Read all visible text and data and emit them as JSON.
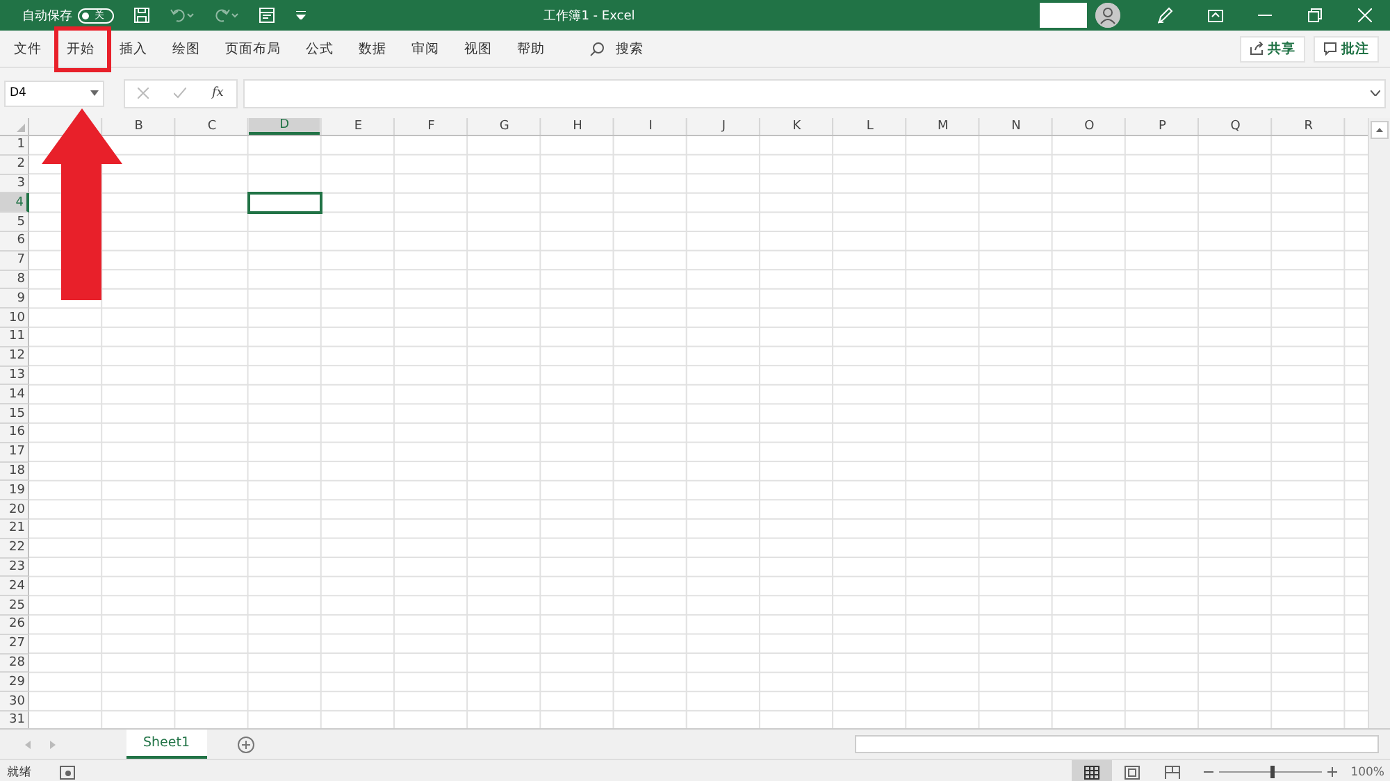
{
  "title_bar": {
    "autosave_label": "自动保存",
    "autosave_on": false,
    "autosave_state": "关",
    "title": "工作簿1  -  Excel"
  },
  "ribbon_tabs": [
    {
      "label": "文件",
      "selected": false
    },
    {
      "label": "开始",
      "selected": false
    },
    {
      "label": "插入",
      "selected": false
    },
    {
      "label": "绘图",
      "selected": false
    },
    {
      "label": "页面布局",
      "selected": false
    },
    {
      "label": "公式",
      "selected": false
    },
    {
      "label": "数据",
      "selected": false
    },
    {
      "label": "审阅",
      "selected": false
    },
    {
      "label": "视图",
      "selected": false
    },
    {
      "label": "帮助",
      "selected": false
    }
  ],
  "search": {
    "label": "搜索"
  },
  "ribbon_buttons": {
    "share": "共享",
    "comments": "批注"
  },
  "formula_bar": {
    "name_box": "D4",
    "fx": "fx"
  },
  "grid": {
    "columns": [
      {
        "label": "B",
        "selected": false
      },
      {
        "label": "C",
        "selected": false
      },
      {
        "label": "D",
        "selected": true
      },
      {
        "label": "E",
        "selected": false
      },
      {
        "label": "F",
        "selected": false
      },
      {
        "label": "G",
        "selected": false
      },
      {
        "label": "H",
        "selected": false
      },
      {
        "label": "I",
        "selected": false
      },
      {
        "label": "J",
        "selected": false
      },
      {
        "label": "K",
        "selected": false
      },
      {
        "label": "L",
        "selected": false
      },
      {
        "label": "M",
        "selected": false
      },
      {
        "label": "N",
        "selected": false
      },
      {
        "label": "O",
        "selected": false
      },
      {
        "label": "P",
        "selected": false
      },
      {
        "label": "Q",
        "selected": false
      },
      {
        "label": "R",
        "selected": false
      }
    ],
    "rows": [
      {
        "label": "1",
        "selected": false
      },
      {
        "label": "2",
        "selected": false
      },
      {
        "label": "3",
        "selected": false
      },
      {
        "label": "4",
        "selected": true
      },
      {
        "label": "5",
        "selected": false
      },
      {
        "label": "6",
        "selected": false
      },
      {
        "label": "7",
        "selected": false
      },
      {
        "label": "8",
        "selected": false
      },
      {
        "label": "9",
        "selected": false
      },
      {
        "label": "10",
        "selected": false
      },
      {
        "label": "11",
        "selected": false
      },
      {
        "label": "12",
        "selected": false
      },
      {
        "label": "13",
        "selected": false
      },
      {
        "label": "14",
        "selected": false
      },
      {
        "label": "15",
        "selected": false
      },
      {
        "label": "16",
        "selected": false
      },
      {
        "label": "17",
        "selected": false
      },
      {
        "label": "18",
        "selected": false
      },
      {
        "label": "19",
        "selected": false
      },
      {
        "label": "20",
        "selected": false
      },
      {
        "label": "21",
        "selected": false
      },
      {
        "label": "22",
        "selected": false
      },
      {
        "label": "23",
        "selected": false
      },
      {
        "label": "24",
        "selected": false
      },
      {
        "label": "25",
        "selected": false
      },
      {
        "label": "26",
        "selected": false
      },
      {
        "label": "27",
        "selected": false
      },
      {
        "label": "28",
        "selected": false
      },
      {
        "label": "29",
        "selected": false
      },
      {
        "label": "30",
        "selected": false
      },
      {
        "label": "31",
        "selected": false
      }
    ]
  },
  "sheet_tabs": [
    {
      "label": "Sheet1",
      "selected": true
    }
  ],
  "status_bar": {
    "status": "就绪",
    "zoom": "100%",
    "level": 0.5
  }
}
